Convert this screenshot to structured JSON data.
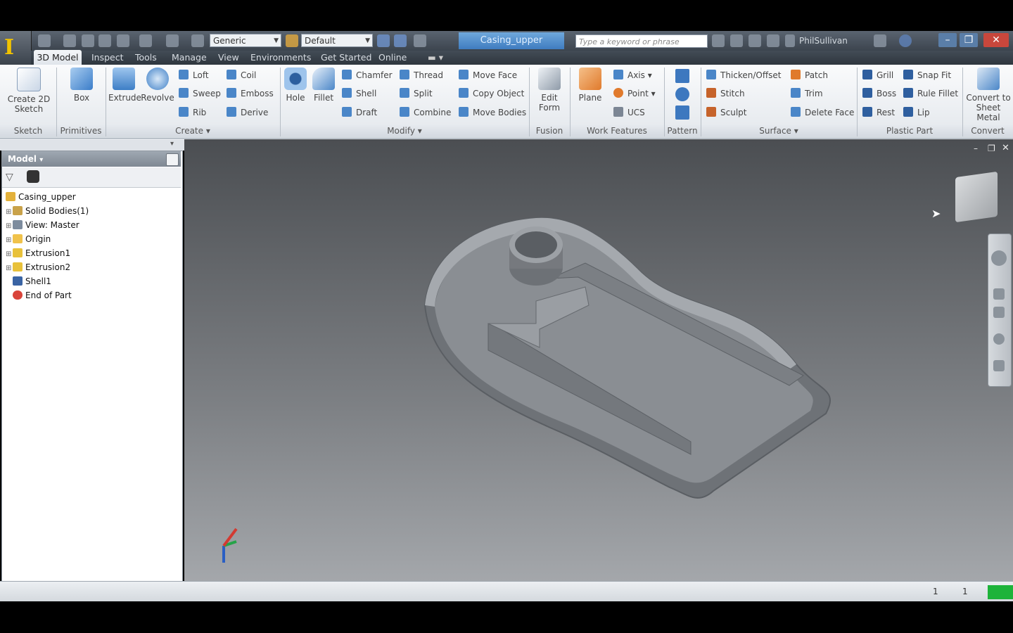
{
  "window": {
    "document_title": "Casing_upper",
    "search_placeholder": "Type a keyword or phrase",
    "user_name": "PhilSullivan",
    "app_glyph": "I"
  },
  "quick_access": {
    "material_combo": "Generic",
    "appearance_combo": "Default",
    "icons": [
      "new-icon",
      "open-icon",
      "save-icon",
      "undo-icon",
      "redo-icon",
      "select-icon",
      "update-icon",
      "properties-icon"
    ]
  },
  "tabs": [
    "3D Model",
    "Inspect",
    "Tools",
    "Manage",
    "View",
    "Environments",
    "Get Started",
    "Online"
  ],
  "ribbon": {
    "groups": [
      {
        "label": "Sketch",
        "items": [
          "Create 2D Sketch"
        ]
      },
      {
        "label": "Primitives",
        "items": [
          "Box"
        ]
      },
      {
        "label": "Create",
        "items": [
          "Extrude",
          "Revolve",
          "Loft",
          "Sweep",
          "Rib",
          "Coil",
          "Emboss",
          "Derive"
        ]
      },
      {
        "label": "Modify",
        "items": [
          "Hole",
          "Fillet",
          "Chamfer",
          "Shell",
          "Draft",
          "Thread",
          "Split",
          "Combine",
          "Move Face",
          "Copy Object",
          "Move Bodies"
        ]
      },
      {
        "label": "Fusion",
        "items": [
          "Edit Form"
        ]
      },
      {
        "label": "Work Features",
        "items": [
          "Plane",
          "Axis",
          "Point",
          "UCS"
        ]
      },
      {
        "label": "Pattern",
        "items": []
      },
      {
        "label": "Surface",
        "items": [
          "Thicken/Offset",
          "Stitch",
          "Sculpt",
          "Patch",
          "Trim",
          "Delete Face"
        ]
      },
      {
        "label": "Plastic Part",
        "items": [
          "Grill",
          "Boss",
          "Rest",
          "Snap Fit",
          "Rule Fillet",
          "Lip"
        ]
      },
      {
        "label": "Convert",
        "items": [
          "Convert to Sheet Metal"
        ]
      }
    ]
  },
  "browser": {
    "title": "Model",
    "tree": [
      {
        "label": "Casing_upper",
        "icon": "part-icon"
      },
      {
        "label": "Solid Bodies(1)",
        "icon": "solid-bodies-icon"
      },
      {
        "label": "View: Master",
        "icon": "view-icon"
      },
      {
        "label": "Origin",
        "icon": "folder-icon"
      },
      {
        "label": "Extrusion1",
        "icon": "extrusion-icon"
      },
      {
        "label": "Extrusion2",
        "icon": "extrusion-icon"
      },
      {
        "label": "Shell1",
        "icon": "shell-icon"
      },
      {
        "label": "End of Part",
        "icon": "end-of-part-icon"
      }
    ]
  },
  "status": {
    "count_a": "1",
    "count_b": "1"
  },
  "colors": {
    "accent": "#3f7cc0",
    "part": "#808489",
    "status_green": "#1db33a"
  }
}
